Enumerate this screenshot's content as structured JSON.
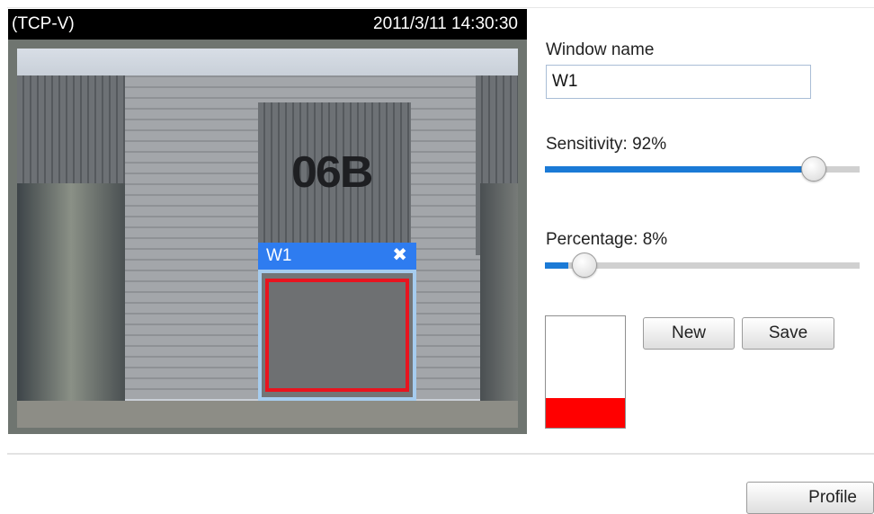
{
  "viewer": {
    "protocol": "(TCP-V)",
    "timestamp": "2011/3/11 14:30:30",
    "building_sign": "06B"
  },
  "motion_window": {
    "title": "W1",
    "close_glyph": "✖"
  },
  "form": {
    "window_name_label": "Window name",
    "window_name_value": "W1",
    "sensitivity_label": "Sensitivity: 92%",
    "sensitivity_value": 0.92,
    "percentage_label": "Percentage: 8%",
    "percentage_value": 0.08
  },
  "activity_level": {
    "fill_fraction": 0.27,
    "fill_color": "#ff0000"
  },
  "buttons": {
    "new_label": "New",
    "save_label": "Save",
    "profile_label": "Profile"
  },
  "colors": {
    "accent": "#1b7ad6",
    "motion_header": "#2e7cf0",
    "alert": "#e8141f"
  }
}
